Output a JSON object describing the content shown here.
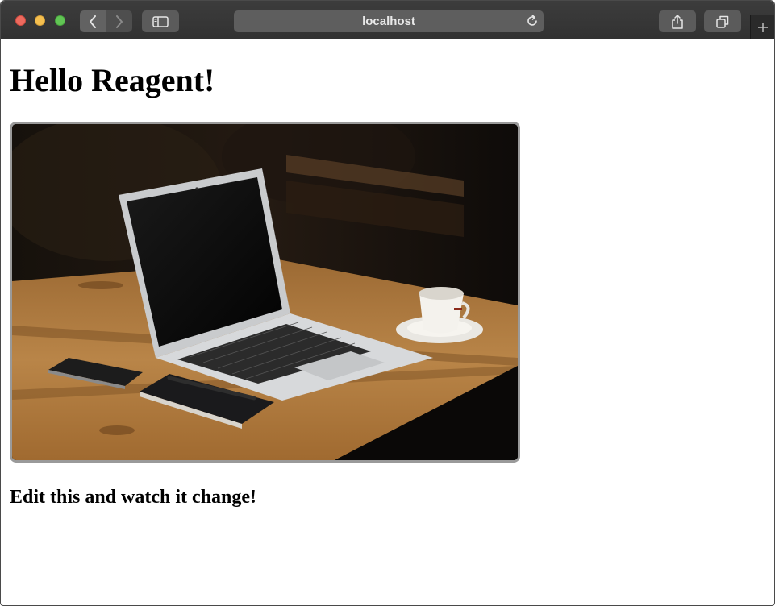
{
  "browser": {
    "address": "localhost",
    "icons": [
      "back-icon",
      "forward-icon",
      "sidebar-icon",
      "reload-icon",
      "share-icon",
      "tabs-icon",
      "plus-icon"
    ]
  },
  "page": {
    "title": "Hello Reagent!",
    "photo_alt": "Laptop, phone, notebook and coffee cup on a wooden table",
    "subtitle": "Edit this and watch it change!"
  },
  "colors": {
    "close": "#ed6a5e",
    "minimize": "#f5bf4f",
    "zoom": "#61c554",
    "toolbar": "#363636"
  }
}
